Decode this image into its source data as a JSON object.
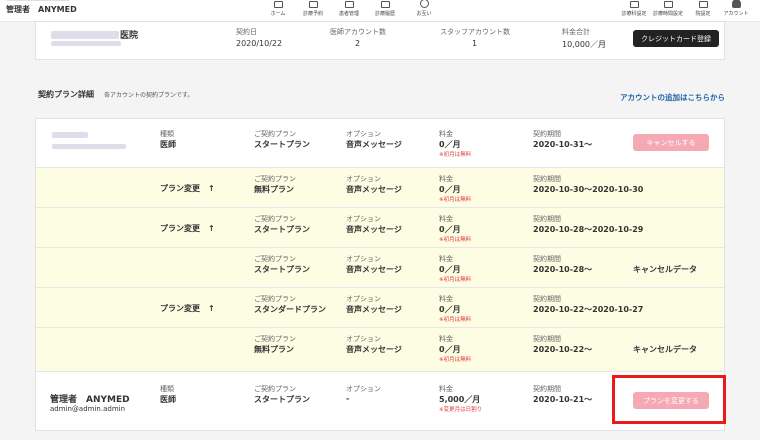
{
  "header": {
    "admin": "管理者　ANYMED",
    "nav": [
      {
        "label": "ホーム",
        "icon": "home-icon"
      },
      {
        "label": "診療予約",
        "icon": "calendar-icon"
      },
      {
        "label": "患者管理",
        "icon": "patients-icon"
      },
      {
        "label": "診療履歴",
        "icon": "history-icon"
      },
      {
        "label": "お互い",
        "icon": "message-icon"
      }
    ],
    "right_nav": [
      {
        "label": "診療科設定",
        "icon": "department-settings-icon"
      },
      {
        "label": "診療時間設定",
        "icon": "time-settings-icon"
      },
      {
        "label": "院設定",
        "icon": "clinic-settings-icon"
      },
      {
        "label": "アカウント",
        "icon": "account-icon"
      }
    ]
  },
  "summary": {
    "contract_date_label": "契約日",
    "contract_date": "2020/10/22",
    "doctor_accounts_label": "医師アカウント数",
    "doctor_accounts": "2",
    "staff_accounts_label": "スタッフアカウント数",
    "staff_accounts": "1",
    "fee_total_label": "料金合計",
    "fee_total": "10,000／月",
    "credit_button": "クレジットカード登録",
    "clinic_suffix": "医院"
  },
  "section": {
    "title": "契約プラン詳細",
    "subtitle": "各アカウントの契約プランです。",
    "add_link": "アカウントの追加はこちらから"
  },
  "labels": {
    "role": "種類",
    "plan": "ご契約プラン",
    "option": "オプション",
    "fee": "料金",
    "period": "契約期間",
    "first_month_free": "※初月は無料",
    "change_prorated": "※変更月は日割り",
    "plan_change": "プラン変更　↑"
  },
  "account1": {
    "role": "医師",
    "plan": "スタートプラン",
    "option": "音声メッセージ",
    "fee": "0／月",
    "period": "2020-10-31〜",
    "cancel_button": "キャンセルする"
  },
  "history": [
    {
      "show_change": true,
      "plan": "無料プラン",
      "option": "音声メッセージ",
      "fee": "0／月",
      "period": "2020-10-30〜2020-10-30",
      "status": ""
    },
    {
      "show_change": true,
      "plan": "スタートプラン",
      "option": "音声メッセージ",
      "fee": "0／月",
      "period": "2020-10-28〜2020-10-29",
      "status": ""
    },
    {
      "show_change": false,
      "plan": "スタートプラン",
      "option": "音声メッセージ",
      "fee": "0／月",
      "period": "2020-10-28〜",
      "status": "キャンセルデータ"
    },
    {
      "show_change": true,
      "plan": "スタンダードプラン",
      "option": "音声メッセージ",
      "fee": "0／月",
      "period": "2020-10-22〜2020-10-27",
      "status": ""
    },
    {
      "show_change": false,
      "plan": "無料プラン",
      "option": "音声メッセージ",
      "fee": "0／月",
      "period": "2020-10-22〜",
      "status": "キャンセルデータ"
    }
  ],
  "account2": {
    "name": "管理者　ANYMED",
    "email": "admin@admin.admin",
    "role": "医師",
    "plan": "スタートプラン",
    "option": "-",
    "fee": "5,000／月",
    "period": "2020-10-21〜",
    "change_button": "プランを変更する"
  }
}
